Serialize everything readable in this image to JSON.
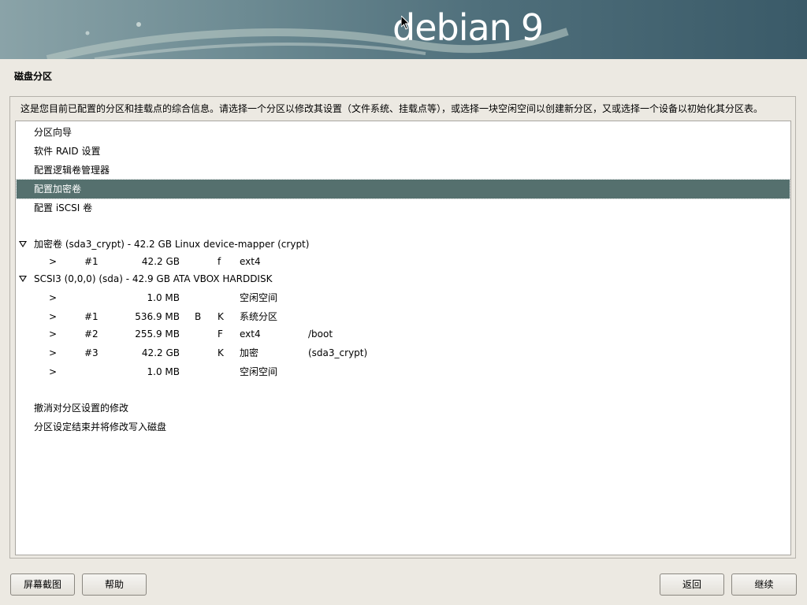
{
  "banner": {
    "logo_word": "debian",
    "logo_version": "9"
  },
  "page_title": "磁盘分区",
  "description": "这是您目前已配置的分区和挂载点的综合信息。请选择一个分区以修改其设置（文件系统、挂载点等），或选择一块空闲空间以创建新分区，又或选择一个设备以初始化其分区表。",
  "menu_items": [
    {
      "label": "分区向导"
    },
    {
      "label": "软件 RAID 设置"
    },
    {
      "label": "配置逻辑卷管理器"
    },
    {
      "label": "配置加密卷",
      "selected": true
    },
    {
      "label": "配置 iSCSI 卷"
    }
  ],
  "devices": [
    {
      "label": "加密卷 (sda3_crypt) - 42.2 GB Linux device-mapper (crypt)",
      "partitions": [
        {
          "arrow": ">",
          "num": "#1",
          "size": "42.2 GB",
          "flag1": "",
          "flag2": "f",
          "type": "ext4",
          "mount": ""
        }
      ]
    },
    {
      "label": "SCSI3 (0,0,0) (sda) - 42.9 GB ATA VBOX HARDDISK",
      "partitions": [
        {
          "arrow": ">",
          "num": "",
          "size": "1.0 MB",
          "flag1": "",
          "flag2": "",
          "type": "空闲空间",
          "mount": ""
        },
        {
          "arrow": ">",
          "num": "#1",
          "size": "536.9 MB",
          "flag1": "B",
          "flag2": "K",
          "type": "系统分区",
          "mount": ""
        },
        {
          "arrow": ">",
          "num": "#2",
          "size": "255.9 MB",
          "flag1": "",
          "flag2": "F",
          "type": "ext4",
          "mount": "/boot"
        },
        {
          "arrow": ">",
          "num": "#3",
          "size": "42.2 GB",
          "flag1": "",
          "flag2": "K",
          "type": "加密",
          "mount": "(sda3_crypt)"
        },
        {
          "arrow": ">",
          "num": "",
          "size": "1.0 MB",
          "flag1": "",
          "flag2": "",
          "type": "空闲空间",
          "mount": ""
        }
      ]
    }
  ],
  "actions": [
    {
      "label": "撤消对分区设置的修改"
    },
    {
      "label": "分区设定结束并将修改写入磁盘"
    }
  ],
  "buttons": {
    "screenshot": "屏幕截图",
    "help": "帮助",
    "back": "返回",
    "continue": "继续"
  }
}
